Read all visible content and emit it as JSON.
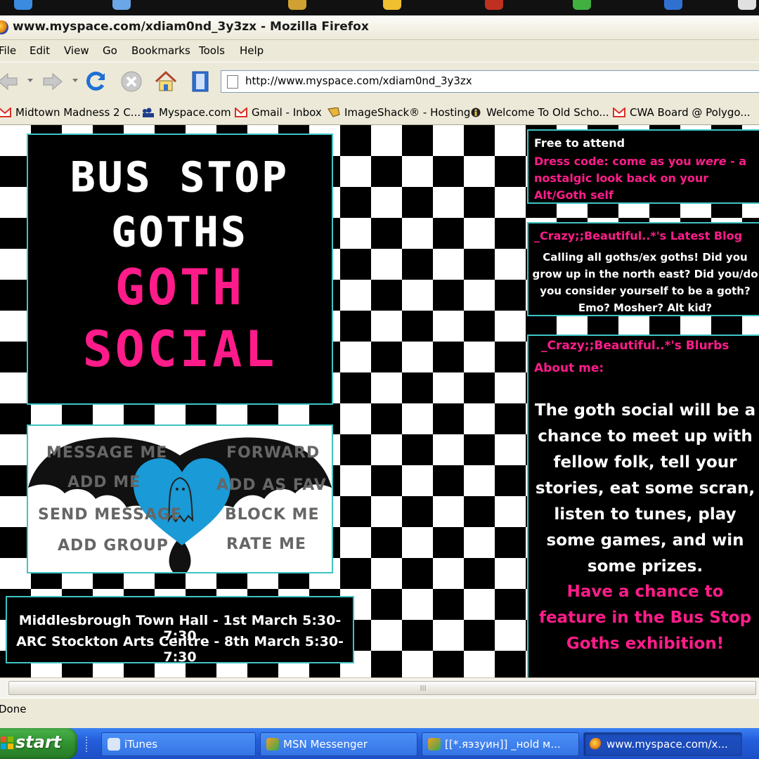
{
  "browser": {
    "window_title": "www.myspace.com/xdiam0nd_3y3zx - Mozilla Firefox",
    "url": "http://www.myspace.com/xdiam0nd_3y3zx",
    "status": "Done"
  },
  "menu": [
    "File",
    "Edit",
    "View",
    "Go",
    "Bookmarks",
    "Tools",
    "Help"
  ],
  "bookmarks": [
    {
      "label": "Midtown Madness 2 C...",
      "icon": "gmail-icon"
    },
    {
      "label": "Myspace.com",
      "icon": "myspace-icon"
    },
    {
      "label": "Gmail - Inbox",
      "icon": "gmail-icon"
    },
    {
      "label": "ImageShack® - Hosting",
      "icon": "imageshack-icon"
    },
    {
      "label": "Welcome To Old Scho...",
      "icon": "figure-icon"
    },
    {
      "label": "CWA Board @ Polygo...",
      "icon": "gmail-icon"
    }
  ],
  "page": {
    "title_lines": [
      "BUS STOP",
      "GOTHS",
      "GOTH",
      "SOCIAL"
    ],
    "bat_buttons": {
      "message_me": "MESSAGE ME",
      "forward": "FORWARD",
      "add_me": "ADD ME",
      "add_as_fav": "ADD AS FAV",
      "send_message": "SEND MESSAGE",
      "block_me": "BLOCK ME",
      "add_group": "ADD GROUP",
      "rate_me": "RATE ME"
    },
    "venues": [
      "Middlesbrough Town Hall - 1st March 5:30-7:30",
      "ARC Stockton Arts Centre - 8th March 5:30-7:30"
    ],
    "info": {
      "free": "Free to attend",
      "dress_code_a": "Dress code: come as you ",
      "dress_code_em": "were",
      "dress_code_b": " - a nostalgic look back on your Alt/Goth self"
    },
    "blog": {
      "heading": "_Crazy;;Beautiful..*'s Latest Blog",
      "text": "Calling all goths/ex goths! Did you grow up in the north east? Did you/do you consider yourself to be a goth? Emo? Mosher? Alt kid?"
    },
    "blurbs": {
      "heading": "_Crazy;;Beautiful..*'s Blurbs",
      "about_label": "About me:",
      "body": "The goth social will be a chance to meet up with fellow folk, tell your stories, eat some scran, listen to tunes, play some games, and win some prizes.",
      "highlight": "Have a chance to feature in the Bus Stop Goths exhibition!"
    }
  },
  "taskbar": {
    "start": "start",
    "items": [
      "iTunes",
      "MSN Messenger",
      "[[*.яэзуин]] _ноld м...",
      "www.myspace.com/x..."
    ]
  },
  "colors": {
    "pink": "#ff1c8a",
    "teal": "#3fc4c4",
    "heart": "#1a9ad6"
  }
}
